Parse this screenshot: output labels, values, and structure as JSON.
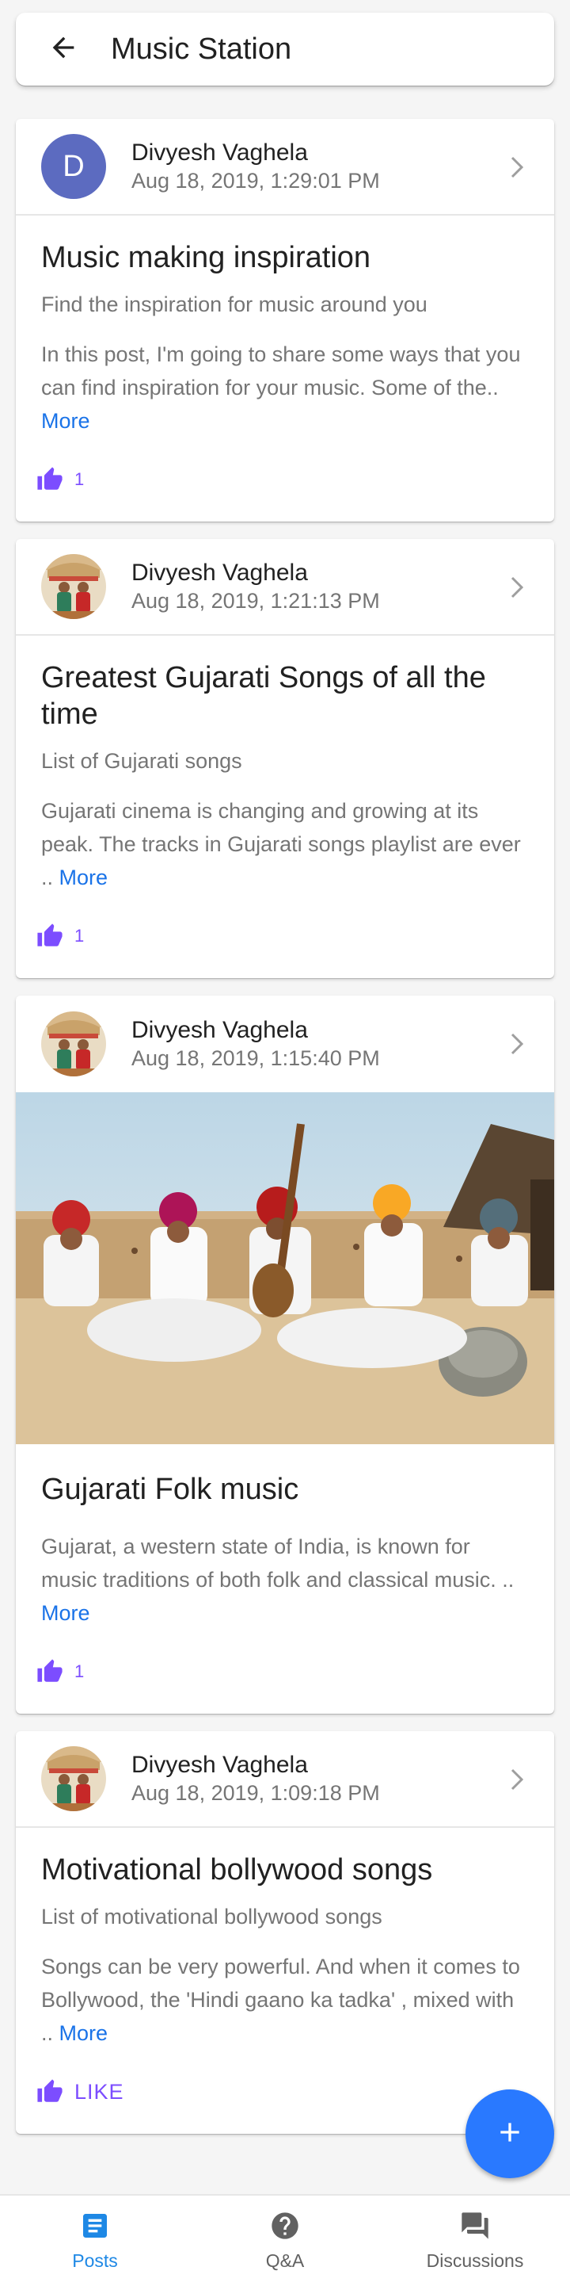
{
  "app_bar": {
    "title": "Music Station",
    "back_icon": "arrow-back-icon"
  },
  "posts": [
    {
      "author": "Divyesh Vaghela",
      "date": "Aug 18, 2019, 1:29:01 PM",
      "avatar": {
        "type": "letter",
        "letter": "D",
        "color": "#5c6bc0"
      },
      "title": "Music making inspiration",
      "subtitle": "Find the inspiration for music around you",
      "excerpt": "In this post, I'm going to share some ways that you can find inspiration for your music. Some of the..",
      "more_label": "More",
      "likes": "1"
    },
    {
      "author": "Divyesh Vaghela",
      "date": "Aug 18, 2019, 1:21:13 PM",
      "avatar": {
        "type": "photo"
      },
      "title": "Greatest Gujarati Songs of all the time",
      "subtitle": "List of Gujarati songs",
      "excerpt": "Gujarati cinema is changing and growing at its peak. The tracks in Gujarati songs playlist are ever ..",
      "more_label": "More",
      "likes": "1"
    },
    {
      "author": "Divyesh Vaghela",
      "date": "Aug 18, 2019, 1:15:40 PM",
      "avatar": {
        "type": "photo"
      },
      "image": "folk-musicians-photo",
      "title": "Gujarati Folk music",
      "excerpt": "Gujarat, a western state of India, is known for music traditions of both folk and classical music. ..",
      "more_label": "More",
      "likes": "1"
    },
    {
      "author": "Divyesh Vaghela",
      "date": "Aug 18, 2019, 1:09:18 PM",
      "avatar": {
        "type": "photo"
      },
      "title": "Motivational bollywood songs",
      "subtitle": "List of motivational bollywood songs",
      "excerpt": "Songs can be very powerful. And when it comes to Bollywood, the 'Hindi gaano ka tadka' , mixed with ..",
      "more_label": "More",
      "like_label": "LIKE"
    }
  ],
  "fab": {
    "icon": "plus-icon",
    "color": "#2979ff"
  },
  "bottom_nav": [
    {
      "label": "Posts",
      "icon": "document-icon",
      "active": true
    },
    {
      "label": "Q&A",
      "icon": "help-circle-icon",
      "active": false
    },
    {
      "label": "Discussions",
      "icon": "forum-icon",
      "active": false
    }
  ],
  "colors": {
    "accent": "#7c4dff",
    "link": "#1a73e8",
    "active_nav": "#1e88e5"
  }
}
